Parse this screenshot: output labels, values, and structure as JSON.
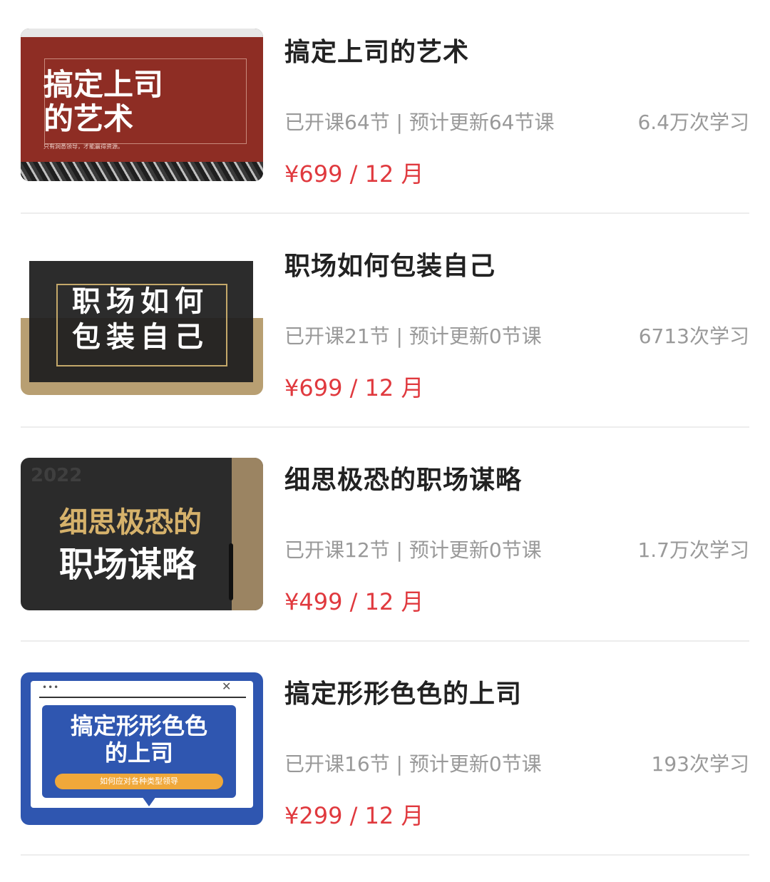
{
  "courses": [
    {
      "title": "搞定上司的艺术",
      "meta": "已开课64节 | 预计更新64节课",
      "count": "6.4万次学习",
      "price": "¥699 / 12 月",
      "thumb": {
        "headline": "搞定上司\n的艺术",
        "sub": "只有洞悉领导，才能赢得资源。"
      }
    },
    {
      "title": "职场如何包装自己",
      "meta": "已开课21节 | 预计更新0节课",
      "count": "6713次学习",
      "price": "¥699 / 12 月",
      "thumb": {
        "headline": "职场如何\n包装自己"
      }
    },
    {
      "title": "细思极恐的职场谋略",
      "meta": "已开课12节 | 预计更新0节课",
      "count": "1.7万次学习",
      "price": "¥499 / 12 月",
      "thumb": {
        "year": "2022",
        "line1": "细思极恐的",
        "line2": "职场谋略"
      }
    },
    {
      "title": "搞定形形色色的上司",
      "meta": "已开课16节 | 预计更新0节课",
      "count": "193次学习",
      "price": "¥299 / 12 月",
      "thumb": {
        "headline": "搞定形形色色\n的上司",
        "pill": "如何应对各种类型领导",
        "dots": "•••",
        "close": "✕"
      }
    }
  ],
  "colors": {
    "price": "#e0393e",
    "title": "#222222",
    "meta": "#999999",
    "divider": "#ededed"
  }
}
